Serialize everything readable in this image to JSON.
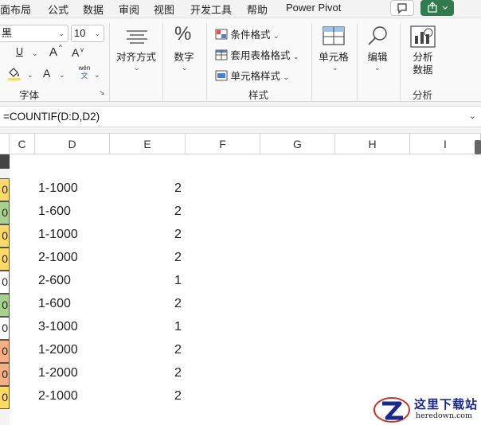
{
  "menu": {
    "items": [
      "面布局",
      "公式",
      "数据",
      "审阅",
      "视图",
      "开发工具",
      "帮助",
      "Power Pivot"
    ],
    "comment_icon": "comment-icon",
    "share_icon": "share-icon"
  },
  "ribbon": {
    "font_name": "黑",
    "font_size": "10",
    "underline": "U",
    "grow_font": "A",
    "shrink_font": "A",
    "font_color_letter": "A",
    "phonetic_top": "wén",
    "phonetic_bottom": "文",
    "font_group": "字体",
    "align_label": "对齐方式",
    "number_label": "数字",
    "number_symbol": "%",
    "conditional_format": "条件格式",
    "table_format": "套用表格格式",
    "cell_style": "单元格样式",
    "styles_group": "样式",
    "cells_label": "单元格",
    "edit_label": "编辑",
    "analyze_label_1": "分析",
    "analyze_label_2": "数据",
    "analysis_group": "分析"
  },
  "formula_bar": {
    "formula": "=COUNTIF(D:D,D2)"
  },
  "columns": [
    "C",
    "D",
    "E",
    "F",
    "G",
    "H",
    "I"
  ],
  "rows": [
    {
      "strip": "0",
      "d": "1-1000",
      "e": "2",
      "color": "#ffd966"
    },
    {
      "strip": "0",
      "d": "1-600",
      "e": "2",
      "color": "#a9d08e"
    },
    {
      "strip": "0",
      "d": "1-1000",
      "e": "2",
      "color": "#ffd966"
    },
    {
      "strip": "0",
      "d": "2-1000",
      "e": "2",
      "color": "#ffd966"
    },
    {
      "strip": "0",
      "d": "2-600",
      "e": "1",
      "color": "#ffffff"
    },
    {
      "strip": "0",
      "d": "1-600",
      "e": "2",
      "color": "#a9d08e"
    },
    {
      "strip": "0",
      "d": "3-1000",
      "e": "1",
      "color": "#ffffff"
    },
    {
      "strip": "0",
      "d": "1-2000",
      "e": "2",
      "color": "#f4b084"
    },
    {
      "strip": "0",
      "d": "1-2000",
      "e": "2",
      "color": "#f4b084"
    },
    {
      "strip": "0",
      "d": "2-1000",
      "e": "2",
      "color": "#ffd966"
    }
  ],
  "watermark": {
    "text": "这里下载站",
    "url": "heredown.com"
  }
}
